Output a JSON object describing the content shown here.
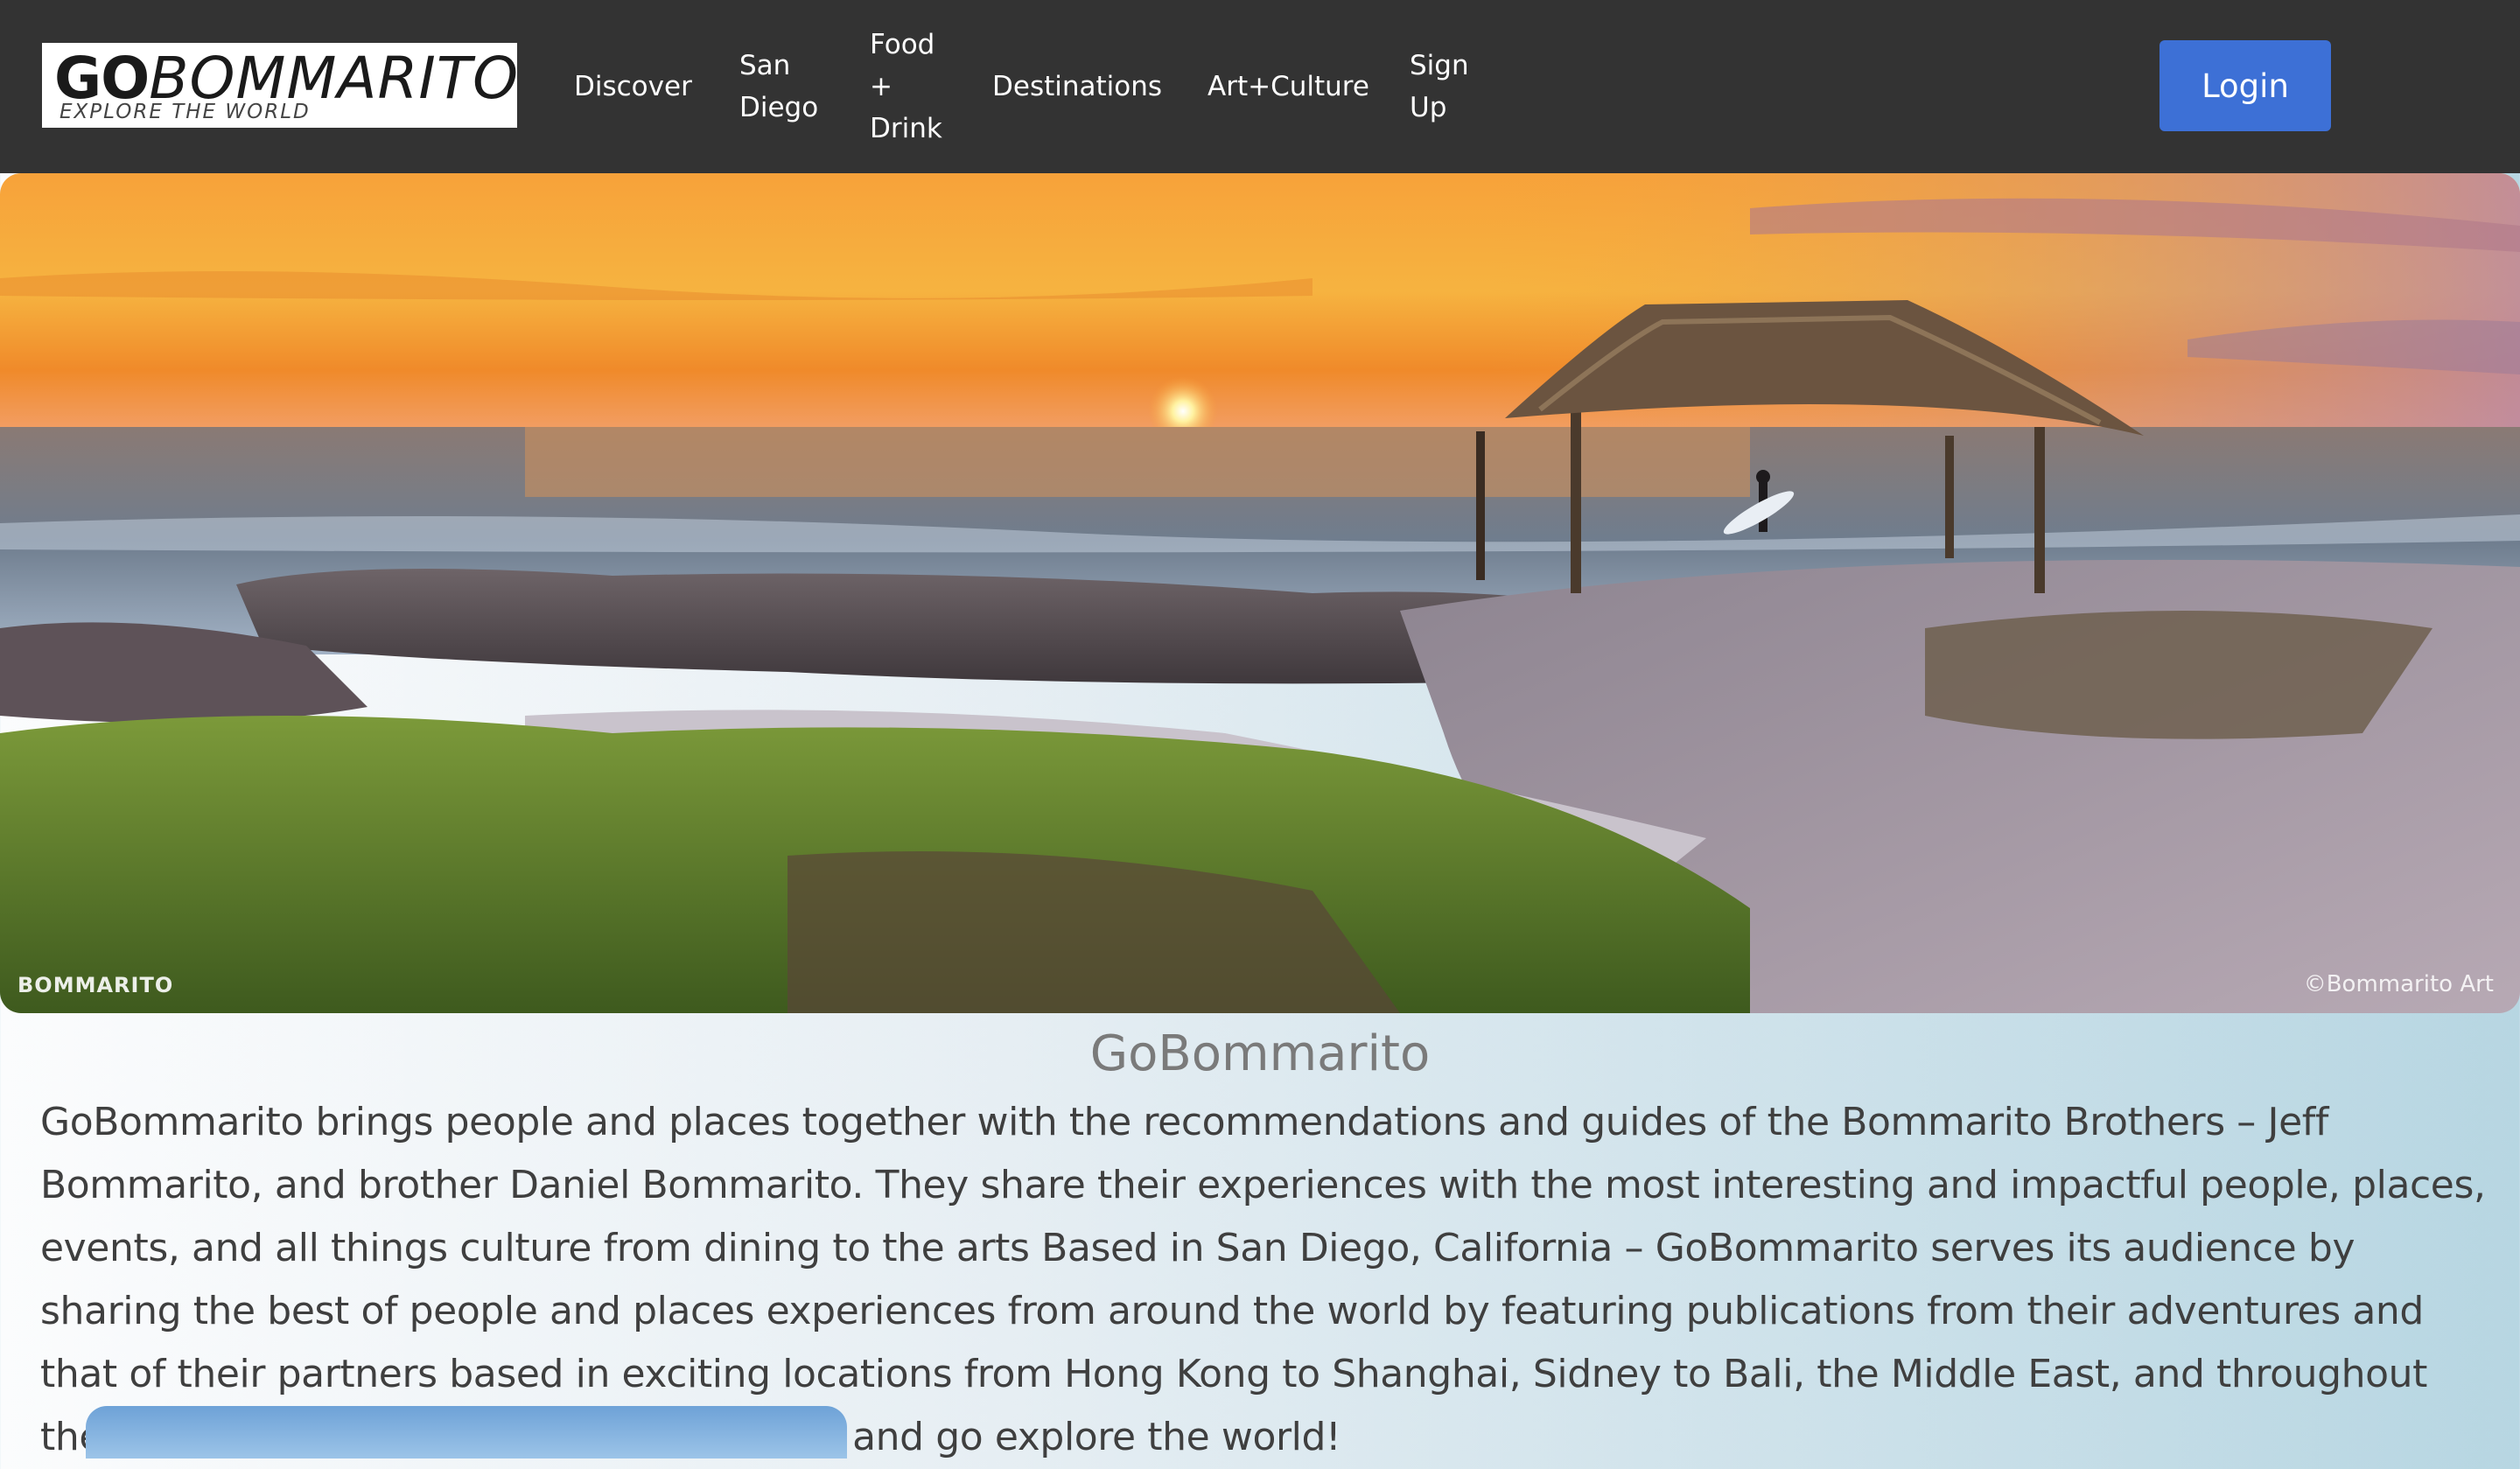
{
  "brand": {
    "logo_main_bold": "GO",
    "logo_main_light": "BOMMARITO",
    "logo_tagline": "EXPLORE THE WORLD"
  },
  "nav": {
    "items": [
      {
        "label": "Discover"
      },
      {
        "label": "San\nDiego"
      },
      {
        "label": "Food\n+\nDrink"
      },
      {
        "label": "Destinations"
      },
      {
        "label": "Art+Culture"
      },
      {
        "label": "Sign\nUp"
      }
    ],
    "login_label": "Login"
  },
  "hero": {
    "watermark_left": "BOMMARITO",
    "watermark_right": "©Bommarito Art"
  },
  "about": {
    "title": "GoBommarito",
    "body": "GoBommarito brings people and places together with the recommendations and guides of the Bommarito Brothers – Jeff Bommarito, and brother Daniel Bommarito. They share their experiences with the most interesting and impactful people, places, events, and all things culture from dining to the arts Based in San Diego, California – GoBommarito serves its audience by sharing the best of people and places experiences from around the world by featuring publications from their adventures and that of their partners based in exciting locations from Hong Kong to Shanghai, Sidney to Bali, the Middle East, and throughout the Americas Join the Bommarito Brothers and go explore the world!"
  },
  "colors": {
    "navbar_bg": "#333333",
    "login_button": "#3d70d6",
    "title_gray": "#7a7a7a"
  }
}
